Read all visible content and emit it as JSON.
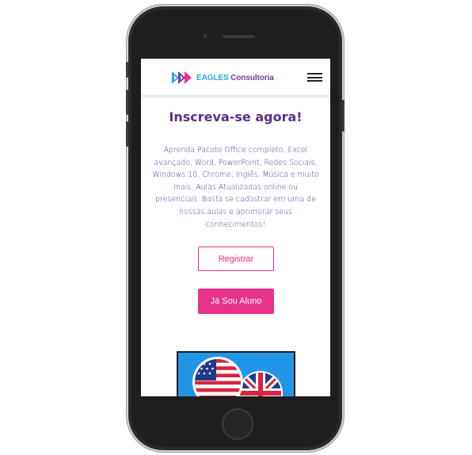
{
  "header": {
    "brand_part1": "EAGLES",
    "brand_part2": "Consultoria",
    "menu_icon": "hamburger-menu-icon"
  },
  "hero": {
    "title": "Inscreva-se agora!",
    "description": "Aprenda Pacote Office completo, Excel avançado, Word, PowerPoint, Redes Sociais, Windows 10, Chrome, Inglês, Música e muito mais. Aulas Atualizadas online ou presenciais. Basta se cadastrar em uma de nossas aulas e aprimorar seus conhecimentos!",
    "register_button": "Registrar",
    "student_button": "Já Sou Aluno"
  },
  "illustration": {
    "icons": [
      "usa-flag-bubble-icon",
      "uk-flag-bubble-icon"
    ]
  },
  "colors": {
    "brand_blue": "#2ca8e0",
    "brand_purple": "#6d3f9c",
    "accent_pink": "#e8338c",
    "heading_purple": "#5b2e8c"
  }
}
